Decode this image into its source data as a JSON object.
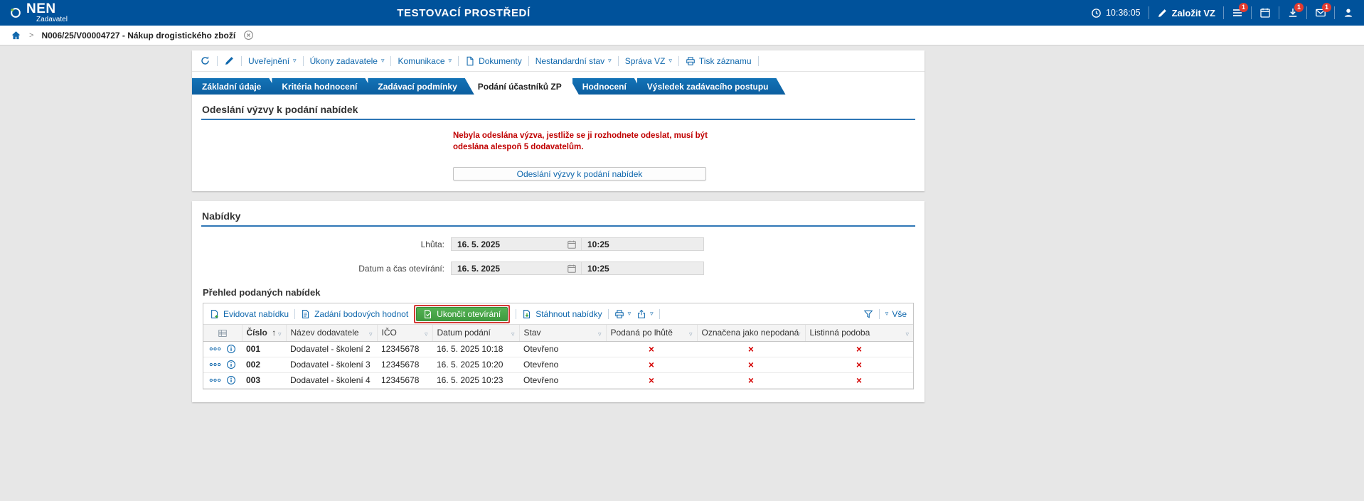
{
  "glyphs": {
    "caret": "▿",
    "sort_asc": "↑",
    "chevron": ">"
  },
  "header": {
    "logo_text": "NEN",
    "logo_subtitle": "Zadavatel",
    "environment_title": "TESTOVACÍ PROSTŘEDÍ",
    "clock_time": "10:36:05",
    "create_vz_label": "Založit VZ",
    "menu_badge": "1",
    "download_badge": "1",
    "mail_badge": "1"
  },
  "breadcrumb": {
    "record_label": "N006/25/V00004727 - Nákup drogistického zboží"
  },
  "record_toolbar": {
    "items": [
      {
        "label": "Uveřejnění"
      },
      {
        "label": "Úkony zadavatele"
      },
      {
        "label": "Komunikace"
      },
      {
        "label": "Dokumenty"
      },
      {
        "label": "Nestandardní stav"
      },
      {
        "label": "Správa VZ"
      },
      {
        "label": "Tisk záznamu"
      }
    ]
  },
  "tabs": [
    {
      "label": "Základní údaje"
    },
    {
      "label": "Kritéria hodnocení"
    },
    {
      "label": "Zadávací podmínky"
    },
    {
      "label": "Podání účastníků ZP"
    },
    {
      "label": "Hodnocení"
    },
    {
      "label": "Výsledek zadávacího postupu"
    }
  ],
  "invite_section": {
    "title": "Odeslání výzvy k podání nabídek",
    "warning": "Nebyla odeslána výzva, jestliže se ji rozhodnete odeslat, musí být odeslána alespoň 5 dodavatelům.",
    "send_button": "Odeslání výzvy k podání nabídek"
  },
  "offers_section": {
    "title": "Nabídky",
    "deadline_label": "Lhůta:",
    "deadline_date": "16. 5. 2025",
    "deadline_time": "10:25",
    "opening_label": "Datum a čas otevírání:",
    "opening_date": "16. 5. 2025",
    "opening_time": "10:25",
    "overview_title": "Přehled podaných nabídek",
    "toolbar": {
      "record_offer": "Evidovat nabídku",
      "enter_points": "Zadání bodových hodnot",
      "end_opening": "Ukončit otevírání",
      "download_offers": "Stáhnout nabídky",
      "filter_all": "Vše"
    },
    "table": {
      "columns": [
        "Číslo",
        "Název dodavatele",
        "IČO",
        "Datum podání",
        "Stav",
        "Podaná po lhůtě",
        "Označena jako nepodaná",
        "Listinná podoba"
      ],
      "rows": [
        {
          "number": "001",
          "supplier": "Dodavatel - školení 2",
          "ico": "12345678",
          "submitted": "16. 5. 2025 10:18",
          "status": "Otevřeno",
          "late": "×",
          "not_submitted": "×",
          "paper": "×"
        },
        {
          "number": "002",
          "supplier": "Dodavatel - školení 3",
          "ico": "12345678",
          "submitted": "16. 5. 2025 10:20",
          "status": "Otevřeno",
          "late": "×",
          "not_submitted": "×",
          "paper": "×"
        },
        {
          "number": "003",
          "supplier": "Dodavatel - školení 4",
          "ico": "12345678",
          "submitted": "16. 5. 2025 10:23",
          "status": "Otevřeno",
          "late": "×",
          "not_submitted": "×",
          "paper": "×"
        }
      ]
    }
  }
}
